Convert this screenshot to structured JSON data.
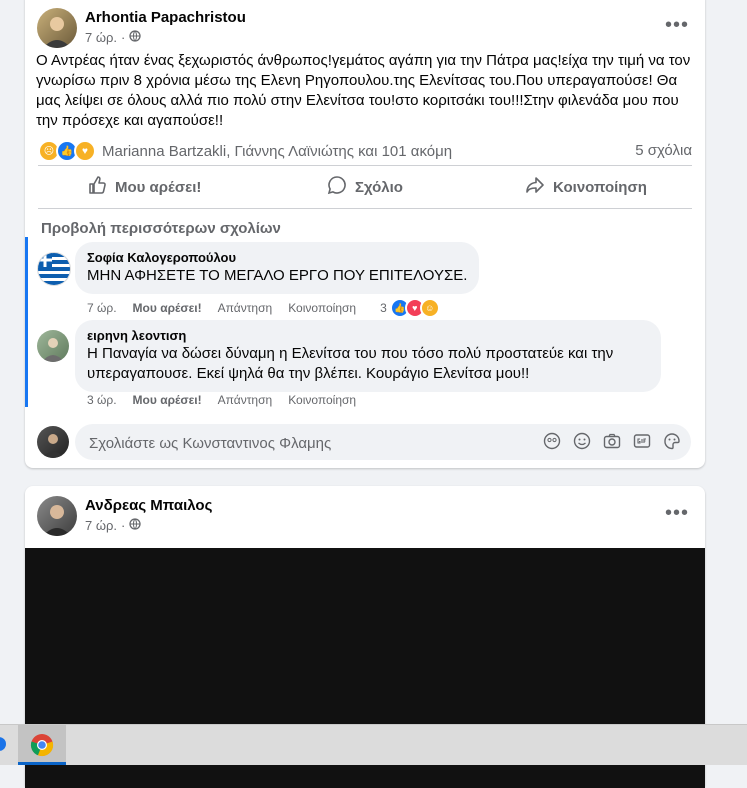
{
  "post1": {
    "author": "Arhontia Papachristou",
    "time": "7 ώρ.",
    "text": "Ο Αντρέας ήταν ένας ξεχωριστός άνθρωπος!γεμάτος αγάπη για την Πάτρα μας!είχα την τιμή να τον γνωρίσω πριν 8 χρόνια μέσω της Ελενη Ρηγοπουλου.της Ελενίτσας του.Που υπεραγαπούσε! Θα μας λείψει σε όλους αλλά πιο πολύ στην Ελενίτσα του!στο κοριτσάκι του!!!Στην φιλενάδα μου που την πρόσεχε και αγαπούσε!!",
    "reactors": "Marianna Bartzakli, Γιάννης Λαϊνιώτης και 101 ακόμη",
    "comment_count": "5 σχόλια",
    "actions": {
      "like": "Μου αρέσει!",
      "comment": "Σχόλιο",
      "share": "Κοινοποίηση"
    },
    "more_comments": "Προβολή περισσότερων σχολίων",
    "comments": [
      {
        "name": "Σοφία Καλογεροπούλου",
        "text": "ΜΗΝ ΑΦΗΣΕΤΕ ΤΟ ΜΕΓΑΛΟ ΕΡΓΟ ΠΟΥ ΕΠΙΤΕΛΟΥΣΕ.",
        "time": "7 ώρ.",
        "like": "Μου αρέσει!",
        "reply": "Απάντηση",
        "share": "Κοινοποίηση",
        "reaction_count": "3"
      },
      {
        "name": "ειρηνη λεοντιση",
        "text": "Η Παναγία να δώσει δύναμη η Ελενίτσα του που τόσο πολύ προστατεύε και την υπεραγαπουσε. Εκεί ψηλά θα την βλέπει. Κουράγιο Ελενίτσα μου!!",
        "time": "3 ώρ.",
        "like": "Μου αρέσει!",
        "reply": "Απάντηση",
        "share": "Κοινοποίηση"
      }
    ],
    "compose_placeholder": "Σχολιάστε ως Κωνσταντινος Φλαμης"
  },
  "post2": {
    "author": "Ανδρεας Μπαιλος",
    "time": "7 ώρ."
  },
  "colors": {
    "like_blue": "#1877f2",
    "love_red": "#f33e58",
    "care_yellow": "#f7b125",
    "secondary_text": "#65676b"
  }
}
